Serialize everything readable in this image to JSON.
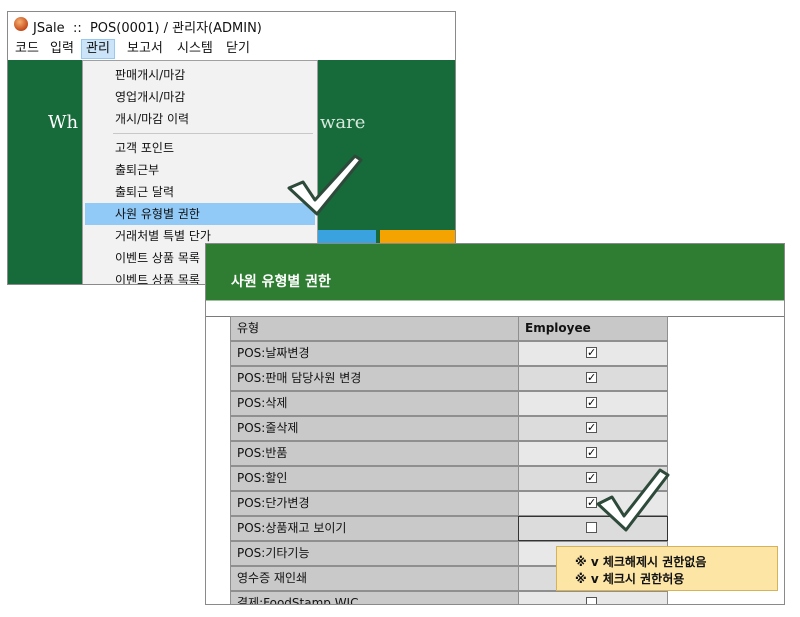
{
  "back_window": {
    "app_name": "JSale",
    "title_sep": "::",
    "title_rest": "POS(0001) / 관리자(ADMIN)",
    "menu": [
      "코드",
      "입력",
      "관리",
      "보고서",
      "시스템",
      "닫기"
    ],
    "active_menu": "관리",
    "hero_left": "Wh",
    "hero_right": "ware",
    "dropdown_items": [
      "판매개시/마감",
      "영업개시/마감",
      "개시/마감 이력",
      "고객 포인트",
      "출퇴근부",
      "출퇴근 달력",
      "사원 유형별 권한",
      "거래처별 특별 단가",
      "이벤트 상품 목록",
      "이벤트 상품 목록"
    ],
    "highlighted_item": "사원 유형별 권한"
  },
  "front_window": {
    "header_title": "사원 유형별 권한",
    "columns": [
      "유형",
      "Employee"
    ],
    "rows": [
      {
        "label": "POS:날짜변경",
        "checked": true
      },
      {
        "label": "POS:판매 담당사원 변경",
        "checked": true
      },
      {
        "label": "POS:삭제",
        "checked": true
      },
      {
        "label": "POS:줄삭제",
        "checked": true
      },
      {
        "label": "POS:반품",
        "checked": true
      },
      {
        "label": "POS:할인",
        "checked": true
      },
      {
        "label": "POS:단가변경",
        "checked": true
      },
      {
        "label": "POS:상품재고 보이기",
        "checked": false
      },
      {
        "label": "POS:기타기능",
        "checked": false
      },
      {
        "label": "영수증 재인쇄",
        "checked": false
      },
      {
        "label": "결제:FoodStamp,WIC",
        "checked": false
      }
    ],
    "note_lines": [
      "※ v 체크해제시 권한없음",
      "※ v 체크시 권한허용"
    ]
  },
  "colors": {
    "green_bg": "#176b3a",
    "header_green": "#2f7d32",
    "highlight_blue": "#91c9f7",
    "note_yellow": "#fde5a6"
  }
}
